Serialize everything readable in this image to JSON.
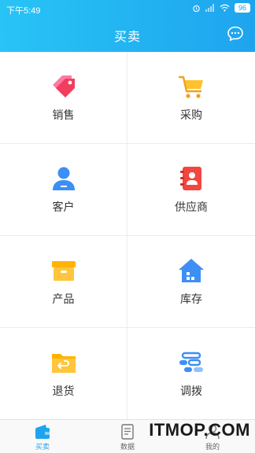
{
  "status_bar": {
    "time": "下午5:49",
    "battery": "96"
  },
  "header": {
    "title": "买卖"
  },
  "grid": [
    {
      "label": "销售"
    },
    {
      "label": "采购"
    },
    {
      "label": "客户"
    },
    {
      "label": "供应商"
    },
    {
      "label": "产品"
    },
    {
      "label": "库存"
    },
    {
      "label": "退货"
    },
    {
      "label": "调拨"
    }
  ],
  "tabs": [
    {
      "label": "买卖",
      "active": true
    },
    {
      "label": "数据",
      "active": false
    },
    {
      "label": "我的",
      "active": false
    }
  ],
  "watermark": "ITMOP.COM",
  "colors": {
    "header_start": "#28c4f6",
    "header_end": "#1ea4ee",
    "accent": "#1ea4ee"
  }
}
